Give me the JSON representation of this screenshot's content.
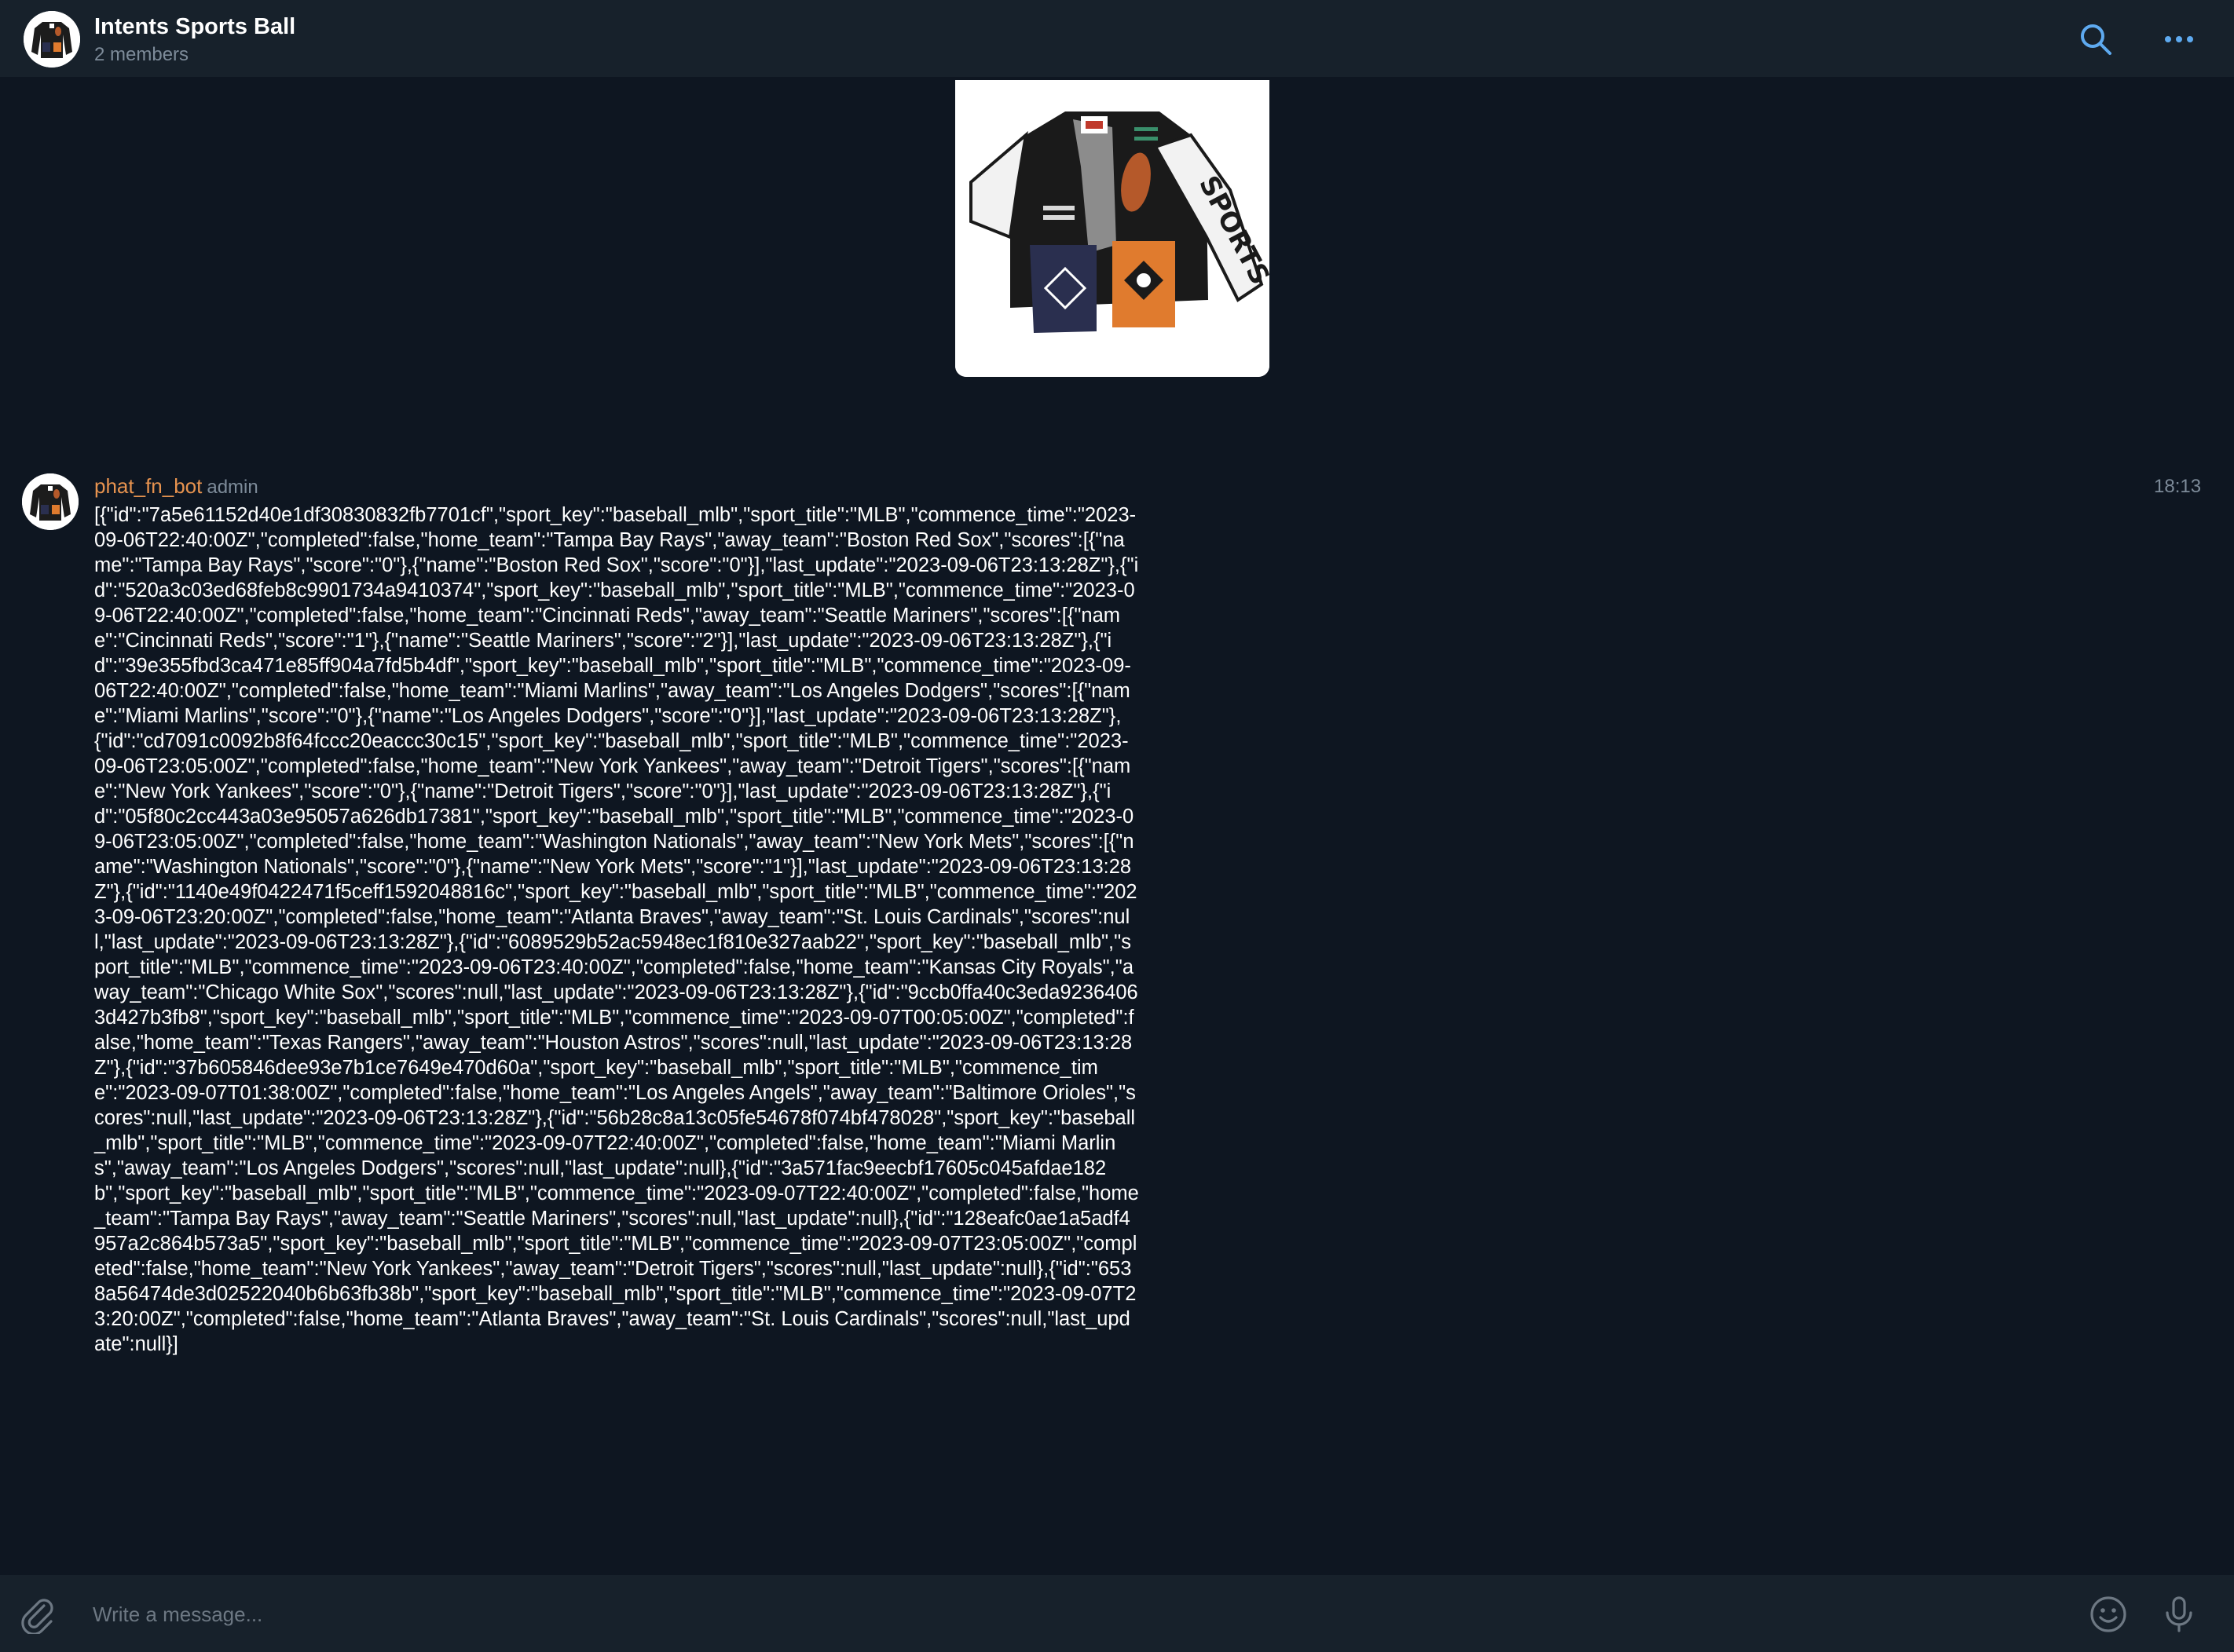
{
  "header": {
    "title": "Intents Sports Ball",
    "subtitle": "2 members"
  },
  "icons": {
    "search": "search-icon",
    "more": "more-horizontal-icon",
    "attach": "paperclip-icon",
    "emoji": "smiley-icon",
    "mic": "microphone-icon",
    "avatar": "sports-jacket-avatar",
    "sticker": "sports-jacket-sticker"
  },
  "colors": {
    "accent": "#5eaaf0",
    "sender_name": "#e7934f",
    "muted": "#7d8b99",
    "header_bg": "#17212b",
    "chat_bg": "#0e1621"
  },
  "message": {
    "sender": "phat_fn_bot",
    "role": "admin",
    "time": "18:13",
    "text": "[{\"id\":\"7a5e61152d40e1df30830832fb7701cf\",\"sport_key\":\"baseball_mlb\",\"sport_title\":\"MLB\",\"commence_time\":\"2023-09-06T22:40:00Z\",\"completed\":false,\"home_team\":\"Tampa Bay Rays\",\"away_team\":\"Boston Red Sox\",\"scores\":[{\"name\":\"Tampa Bay Rays\",\"score\":\"0\"},{\"name\":\"Boston Red Sox\",\"score\":\"0\"}],\"last_update\":\"2023-09-06T23:13:28Z\"},{\"id\":\"520a3c03ed68feb8c9901734a9410374\",\"sport_key\":\"baseball_mlb\",\"sport_title\":\"MLB\",\"commence_time\":\"2023-09-06T22:40:00Z\",\"completed\":false,\"home_team\":\"Cincinnati Reds\",\"away_team\":\"Seattle Mariners\",\"scores\":[{\"name\":\"Cincinnati Reds\",\"score\":\"1\"},{\"name\":\"Seattle Mariners\",\"score\":\"2\"}],\"last_update\":\"2023-09-06T23:13:28Z\"},{\"id\":\"39e355fbd3ca471e85ff904a7fd5b4df\",\"sport_key\":\"baseball_mlb\",\"sport_title\":\"MLB\",\"commence_time\":\"2023-09-06T22:40:00Z\",\"completed\":false,\"home_team\":\"Miami Marlins\",\"away_team\":\"Los Angeles Dodgers\",\"scores\":[{\"name\":\"Miami Marlins\",\"score\":\"0\"},{\"name\":\"Los Angeles Dodgers\",\"score\":\"0\"}],\"last_update\":\"2023-09-06T23:13:28Z\"},{\"id\":\"cd7091c0092b8f64fccc20eaccc30c15\",\"sport_key\":\"baseball_mlb\",\"sport_title\":\"MLB\",\"commence_time\":\"2023-09-06T23:05:00Z\",\"completed\":false,\"home_team\":\"New York Yankees\",\"away_team\":\"Detroit Tigers\",\"scores\":[{\"name\":\"New York Yankees\",\"score\":\"0\"},{\"name\":\"Detroit Tigers\",\"score\":\"0\"}],\"last_update\":\"2023-09-06T23:13:28Z\"},{\"id\":\"05f80c2cc443a03e95057a626db17381\",\"sport_key\":\"baseball_mlb\",\"sport_title\":\"MLB\",\"commence_time\":\"2023-09-06T23:05:00Z\",\"completed\":false,\"home_team\":\"Washington Nationals\",\"away_team\":\"New York Mets\",\"scores\":[{\"name\":\"Washington Nationals\",\"score\":\"0\"},{\"name\":\"New York Mets\",\"score\":\"1\"}],\"last_update\":\"2023-09-06T23:13:28Z\"},{\"id\":\"1140e49f0422471f5ceff1592048816c\",\"sport_key\":\"baseball_mlb\",\"sport_title\":\"MLB\",\"commence_time\":\"2023-09-06T23:20:00Z\",\"completed\":false,\"home_team\":\"Atlanta Braves\",\"away_team\":\"St. Louis Cardinals\",\"scores\":null,\"last_update\":\"2023-09-06T23:13:28Z\"},{\"id\":\"6089529b52ac5948ec1f810e327aab22\",\"sport_key\":\"baseball_mlb\",\"sport_title\":\"MLB\",\"commence_time\":\"2023-09-06T23:40:00Z\",\"completed\":false,\"home_team\":\"Kansas City Royals\",\"away_team\":\"Chicago White Sox\",\"scores\":null,\"last_update\":\"2023-09-06T23:13:28Z\"},{\"id\":\"9ccb0ffa40c3eda92364063d427b3fb8\",\"sport_key\":\"baseball_mlb\",\"sport_title\":\"MLB\",\"commence_time\":\"2023-09-07T00:05:00Z\",\"completed\":false,\"home_team\":\"Texas Rangers\",\"away_team\":\"Houston Astros\",\"scores\":null,\"last_update\":\"2023-09-06T23:13:28Z\"},{\"id\":\"37b605846dee93e7b1ce7649e470d60a\",\"sport_key\":\"baseball_mlb\",\"sport_title\":\"MLB\",\"commence_time\":\"2023-09-07T01:38:00Z\",\"completed\":false,\"home_team\":\"Los Angeles Angels\",\"away_team\":\"Baltimore Orioles\",\"scores\":null,\"last_update\":\"2023-09-06T23:13:28Z\"},{\"id\":\"56b28c8a13c05fe54678f074bf478028\",\"sport_key\":\"baseball_mlb\",\"sport_title\":\"MLB\",\"commence_time\":\"2023-09-07T22:40:00Z\",\"completed\":false,\"home_team\":\"Miami Marlins\",\"away_team\":\"Los Angeles Dodgers\",\"scores\":null,\"last_update\":null},{\"id\":\"3a571fac9eecbf17605c045afdae182b\",\"sport_key\":\"baseball_mlb\",\"sport_title\":\"MLB\",\"commence_time\":\"2023-09-07T22:40:00Z\",\"completed\":false,\"home_team\":\"Tampa Bay Rays\",\"away_team\":\"Seattle Mariners\",\"scores\":null,\"last_update\":null},{\"id\":\"128eafc0ae1a5adf4957a2c864b573a5\",\"sport_key\":\"baseball_mlb\",\"sport_title\":\"MLB\",\"commence_time\":\"2023-09-07T23:05:00Z\",\"completed\":false,\"home_team\":\"New York Yankees\",\"away_team\":\"Detroit Tigers\",\"scores\":null,\"last_update\":null},{\"id\":\"6538a56474de3d02522040b6b63fb38b\",\"sport_key\":\"baseball_mlb\",\"sport_title\":\"MLB\",\"commence_time\":\"2023-09-07T23:20:00Z\",\"completed\":false,\"home_team\":\"Atlanta Braves\",\"away_team\":\"St. Louis Cardinals\",\"scores\":null,\"last_update\":null}]"
  },
  "composer": {
    "placeholder": "Write a message..."
  }
}
